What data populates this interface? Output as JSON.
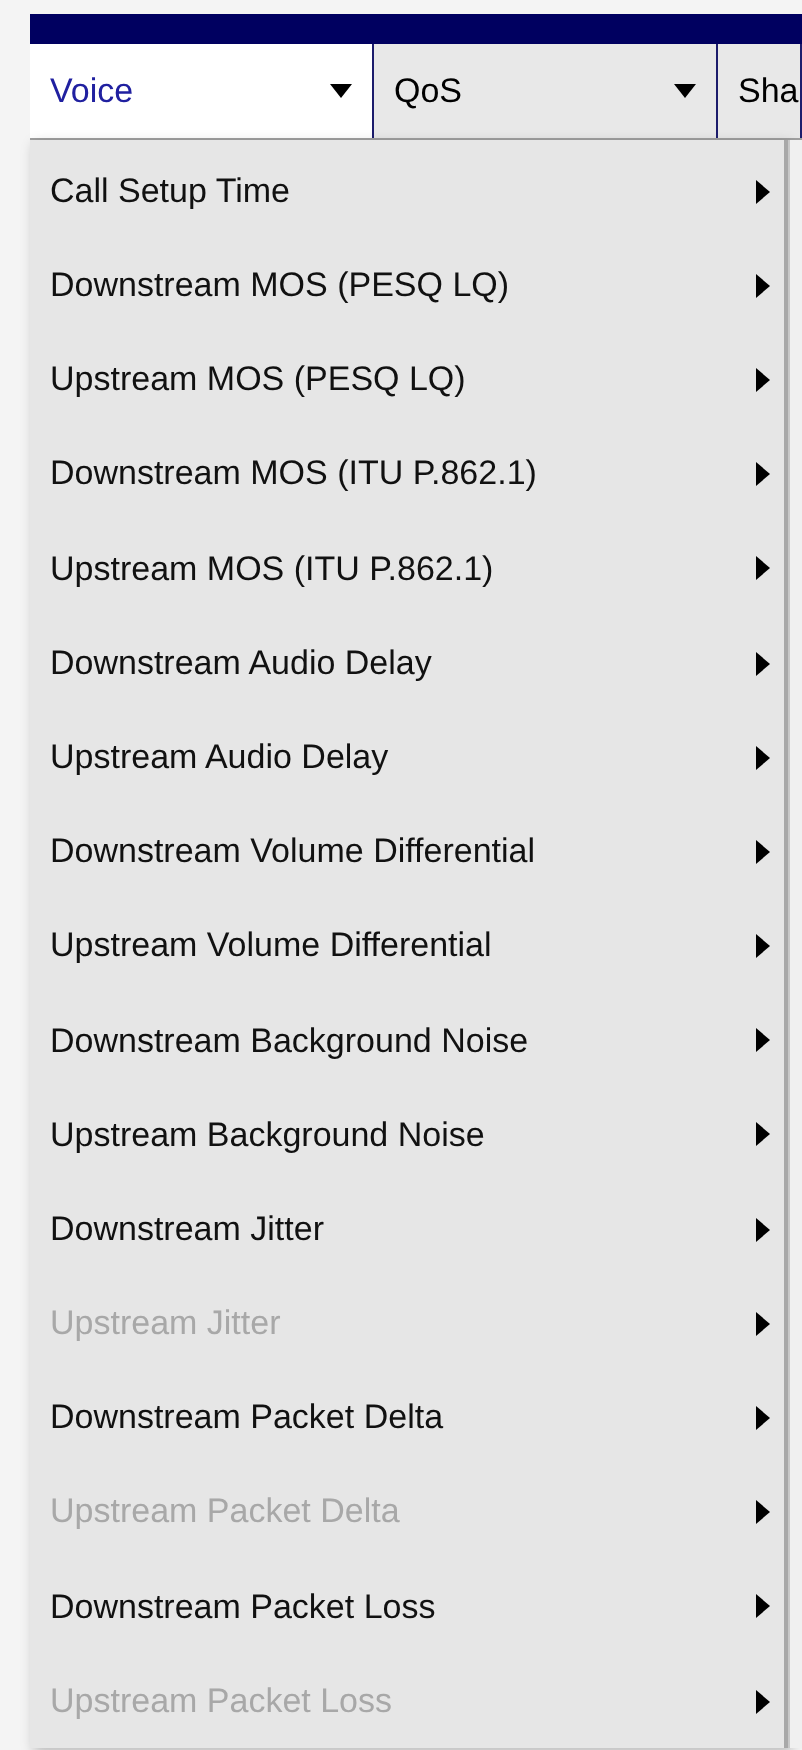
{
  "menu_bar": [
    {
      "label": "Voice",
      "selected": true
    },
    {
      "label": "QoS",
      "selected": false
    },
    {
      "label": "Sha",
      "selected": false
    }
  ],
  "menu_items": [
    {
      "label": "Call Setup Time",
      "disabled": false
    },
    {
      "label": "Downstream MOS (PESQ LQ)",
      "disabled": false
    },
    {
      "label": "Upstream MOS (PESQ LQ)",
      "disabled": false
    },
    {
      "label": "Downstream MOS (ITU P.862.1)",
      "disabled": false
    },
    {
      "label": "Upstream MOS (ITU P.862.1)",
      "disabled": false
    },
    {
      "label": "Downstream Audio Delay",
      "disabled": false
    },
    {
      "label": "Upstream Audio Delay",
      "disabled": false
    },
    {
      "label": "Downstream Volume Differential",
      "disabled": false
    },
    {
      "label": "Upstream Volume Differential",
      "disabled": false
    },
    {
      "label": "Downstream Background Noise",
      "disabled": false
    },
    {
      "label": "Upstream Background Noise",
      "disabled": false
    },
    {
      "label": "Downstream Jitter",
      "disabled": false
    },
    {
      "label": "Upstream Jitter",
      "disabled": true
    },
    {
      "label": "Downstream Packet Delta",
      "disabled": false
    },
    {
      "label": "Upstream Packet Delta",
      "disabled": true
    },
    {
      "label": "Downstream Packet Loss",
      "disabled": false
    },
    {
      "label": "Upstream Packet Loss",
      "disabled": true
    }
  ]
}
